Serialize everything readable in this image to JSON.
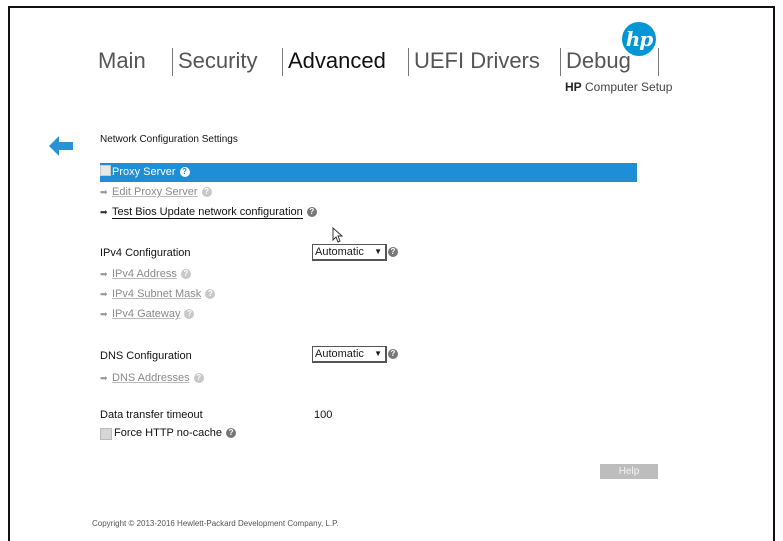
{
  "brand": {
    "logo_text": "hp",
    "subtitle_brand": "HP",
    "subtitle_rest": " Computer Setup"
  },
  "tabs": [
    {
      "label": "Main",
      "active": false
    },
    {
      "label": "Security",
      "active": false
    },
    {
      "label": "Advanced",
      "active": true
    },
    {
      "label": "UEFI Drivers",
      "active": false
    },
    {
      "label": "Debug",
      "active": false
    }
  ],
  "section_title": "Network Configuration Settings",
  "proxy": {
    "proxy_server_label": "Proxy Server",
    "edit_proxy_label": "Edit Proxy Server",
    "test_bios_label": "Test Bios Update network configuration"
  },
  "ipv4": {
    "label": "IPv4 Configuration",
    "selected": "Automatic",
    "address_label": "IPv4 Address",
    "subnet_label": "IPv4 Subnet Mask",
    "gateway_label": "IPv4 Gateway"
  },
  "dns": {
    "label": "DNS Configuration",
    "selected": "Automatic",
    "addresses_label": "DNS Addresses"
  },
  "timeout": {
    "label": "Data transfer timeout",
    "value": "100"
  },
  "force_http": {
    "label": "Force HTTP no-cache"
  },
  "help_button_label": "Help",
  "help_glyph": "?",
  "copyright": "Copyright © 2013-2016 Hewlett-Packard Development Company, L.P.",
  "colors": {
    "accent": "#1e8fd6",
    "logo": "#0096d6"
  }
}
